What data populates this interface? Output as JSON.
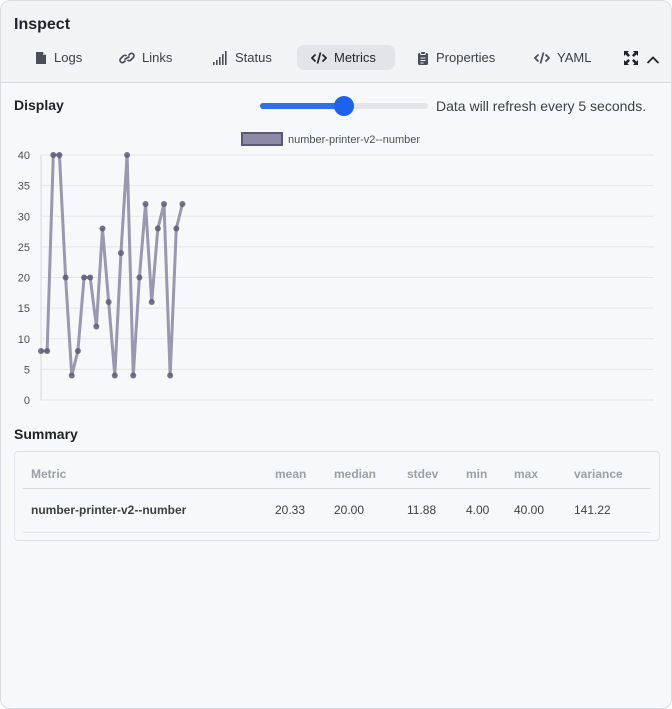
{
  "title": "Inspect",
  "tabs": [
    {
      "label": "Logs",
      "icon": "document-icon"
    },
    {
      "label": "Links",
      "icon": "link-icon"
    },
    {
      "label": "Status",
      "icon": "signal-icon"
    },
    {
      "label": "Metrics",
      "icon": "code-icon",
      "active": true
    },
    {
      "label": "Properties",
      "icon": "clipboard-icon"
    },
    {
      "label": "YAML",
      "icon": "code-icon"
    }
  ],
  "header_icons": [
    "expand-icon",
    "chevron-up-icon"
  ],
  "display": {
    "label": "Display",
    "slider_fraction": 0.5,
    "refresh_text": "Data will refresh every 5 seconds."
  },
  "chart_data": {
    "type": "line",
    "series": [
      {
        "name": "number-printer-v2--number",
        "values": [
          8,
          8,
          40,
          40,
          20,
          4,
          8,
          20,
          20,
          12,
          28,
          16,
          4,
          24,
          40,
          4,
          20,
          32,
          16,
          28,
          32,
          4,
          28,
          32
        ]
      }
    ],
    "ylim": [
      0,
      40
    ],
    "yticks": [
      "0",
      "5",
      "10",
      "15",
      "20",
      "25",
      "30",
      "35",
      "40"
    ],
    "grid": true,
    "legend": "top",
    "colors": {
      "line": "#9a97b0",
      "point": "#5e5a7a",
      "legend_fill": "#8e8aa6",
      "legend_border": "#5b5778"
    }
  },
  "summary": {
    "label": "Summary",
    "columns": [
      "Metric",
      "mean",
      "median",
      "stdev",
      "min",
      "max",
      "variance"
    ],
    "rows": [
      [
        "number-printer-v2--number",
        "20.33",
        "20.00",
        "11.88",
        "4.00",
        "40.00",
        "141.22"
      ]
    ]
  }
}
